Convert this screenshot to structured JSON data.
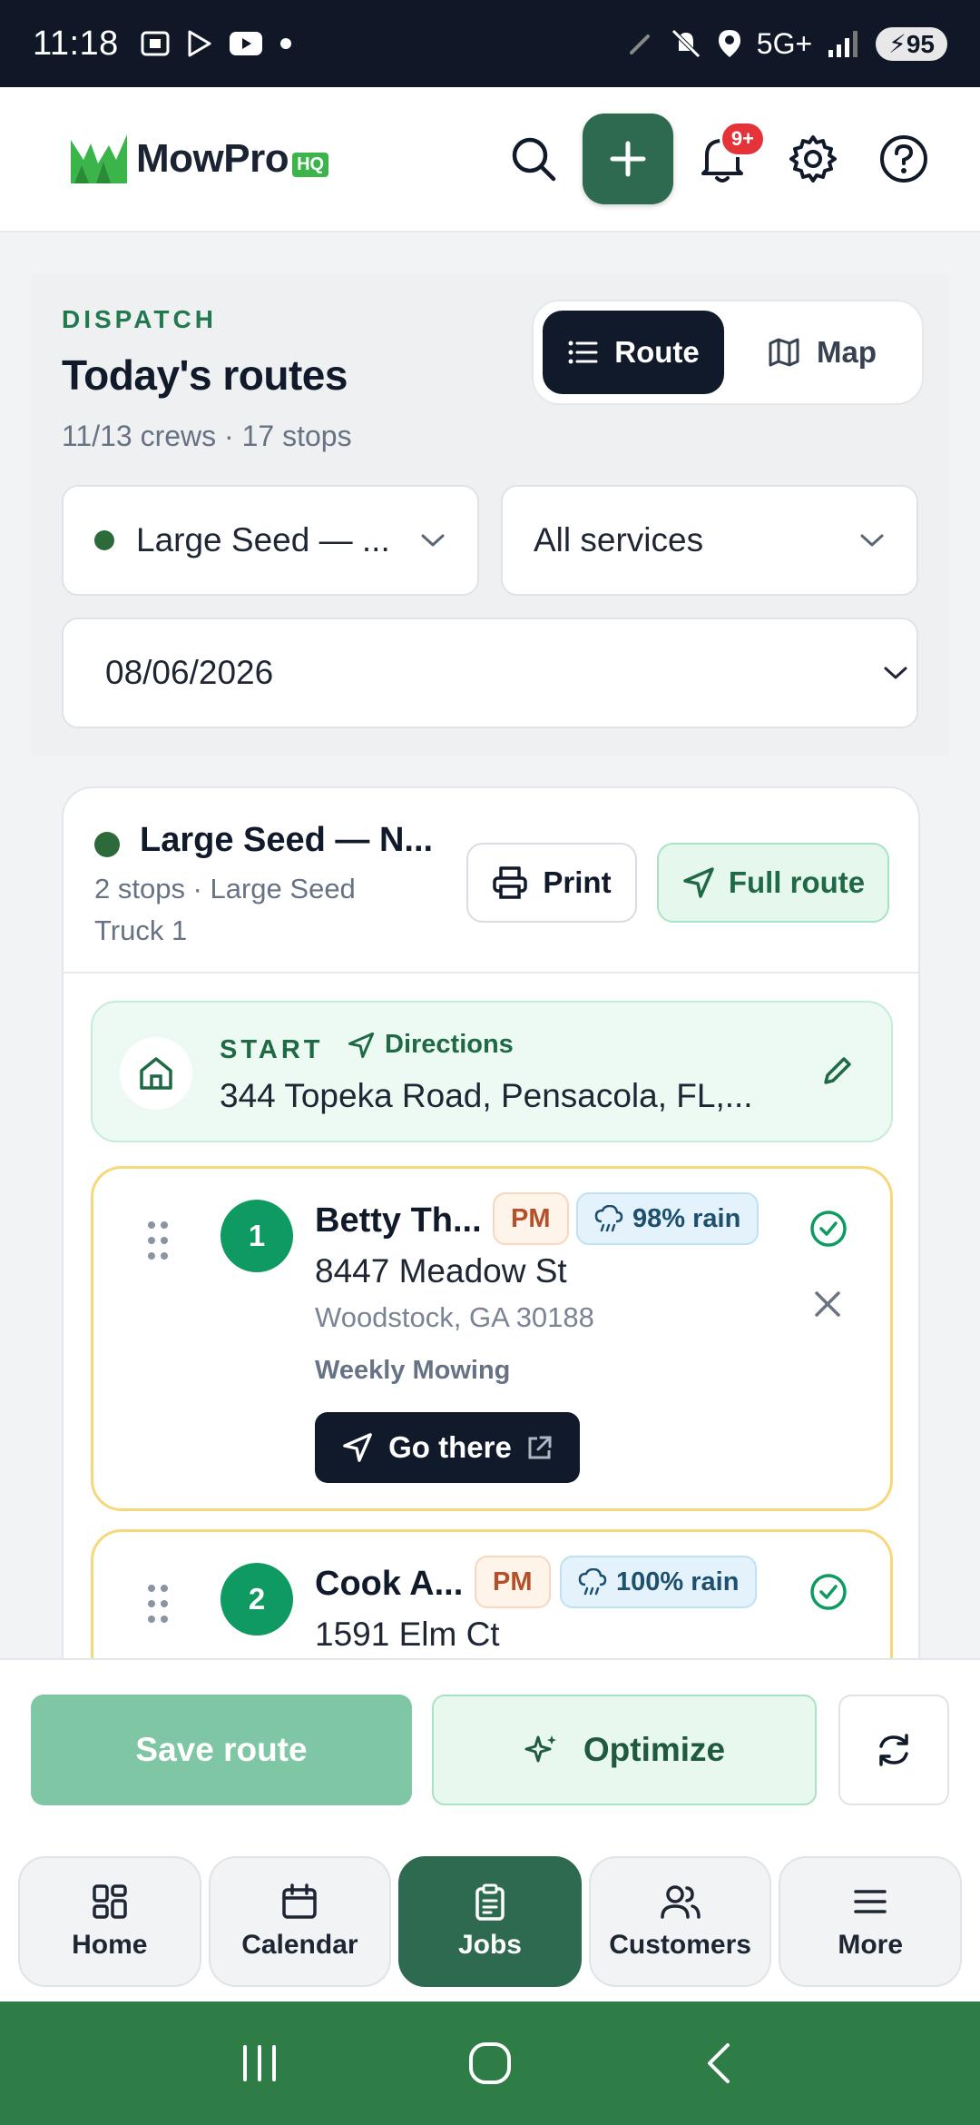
{
  "status_bar": {
    "time": "11:18",
    "network": "5G+",
    "battery": "95"
  },
  "header": {
    "logo_text": "MowPro",
    "logo_badge": "HQ",
    "notification_count": "9+"
  },
  "dispatch": {
    "eyebrow": "DISPATCH",
    "title": "Today's routes",
    "subtitle": "11/13 crews · 17 stops",
    "view_toggle": {
      "route_label": "Route",
      "map_label": "Map",
      "selected": "Route"
    },
    "crew_select": "Large Seed — ...",
    "service_select": "All services",
    "date": "08/06/2026"
  },
  "route_card": {
    "crew_name": "Large Seed — N...",
    "details": "2 stops · Large Seed Truck 1",
    "print_label": "Print",
    "full_route_label": "Full route",
    "start": {
      "label": "START",
      "directions_label": "Directions",
      "address": "344 Topeka Road, Pensacola, FL,..."
    },
    "stops": [
      {
        "number": "1",
        "name": "Betty Th...",
        "tag": "PM",
        "rain": "98% rain",
        "address": "8447 Meadow St",
        "city": "Woodstock, GA 30188",
        "service": "Weekly Mowing",
        "go_label": "Go there"
      },
      {
        "number": "2",
        "name": "Cook A...",
        "tag": "PM",
        "rain": "100% rain",
        "address": "1591 Elm Ct"
      }
    ]
  },
  "actions": {
    "save_label": "Save route",
    "optimize_label": "Optimize"
  },
  "tabs": [
    {
      "label": "Home",
      "icon": "grid-icon"
    },
    {
      "label": "Calendar",
      "icon": "calendar-icon"
    },
    {
      "label": "Jobs",
      "icon": "clipboard-icon",
      "active": true
    },
    {
      "label": "Customers",
      "icon": "users-icon"
    },
    {
      "label": "More",
      "icon": "menu-icon"
    }
  ],
  "colors": {
    "brand_green": "#2d6a4f",
    "dark": "#111a2b",
    "stop_border": "#f6d77b",
    "stop_number": "#0f9a62"
  }
}
